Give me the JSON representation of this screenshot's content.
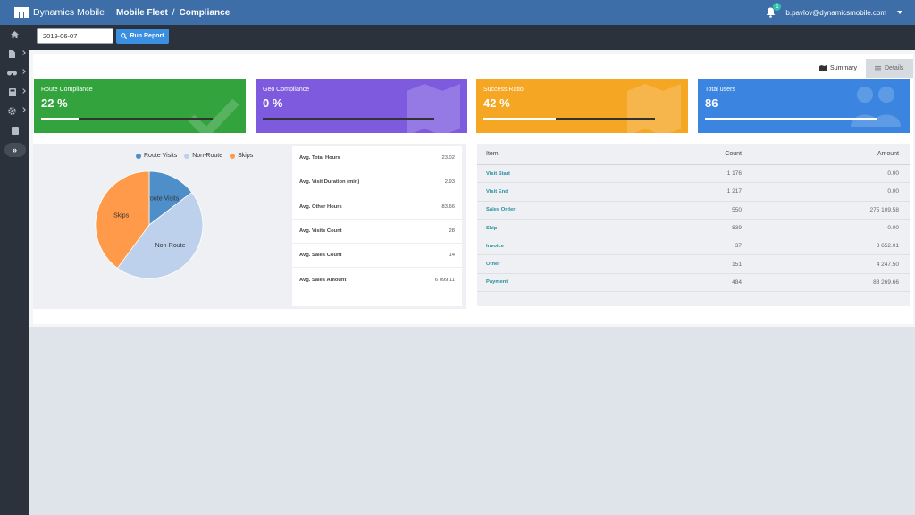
{
  "app": {
    "name": "Dynamics Mobile"
  },
  "breadcrumb": {
    "module": "Mobile Fleet",
    "separator": "/",
    "page": "Compliance"
  },
  "user": {
    "email": "b.pavlov@dynamicsmobile.com",
    "notifications": "1"
  },
  "sidebar": {
    "items": [
      {
        "icon": "home-icon"
      },
      {
        "icon": "document-icon"
      },
      {
        "icon": "binoculars-icon"
      },
      {
        "icon": "calculator-icon"
      },
      {
        "icon": "gear-icon"
      },
      {
        "icon": "book-icon"
      }
    ],
    "toggle_icon": "double-chevron-right-icon"
  },
  "toolbar": {
    "date_value": "2019-06-07",
    "run_label": "Run Report"
  },
  "tabs": [
    {
      "label": "Summary",
      "icon": "map-icon"
    },
    {
      "label": "Details",
      "icon": "list-icon"
    }
  ],
  "cards": [
    {
      "title": "Route Compliance",
      "value": "22 %",
      "progress": 0.22,
      "color": "#33a33d",
      "icon": "check-icon"
    },
    {
      "title": "Geo Compliance",
      "value": "0 %",
      "progress": 0.0,
      "color": "#7e5bde",
      "icon": "map-icon"
    },
    {
      "title": "Success Ratio",
      "value": "42 %",
      "progress": 0.42,
      "color": "#f5a623",
      "icon": "map-icon"
    },
    {
      "title": "Total users",
      "value": "86",
      "progress": 1.0,
      "color": "#3b85e0",
      "icon": "users-icon"
    }
  ],
  "chart_data": {
    "type": "pie",
    "categories": [
      "Route Visits",
      "Non-Route",
      "Skips"
    ],
    "values": [
      14.6,
      45.5,
      39.9
    ],
    "colors": [
      "#4e8fc9",
      "#bdd1ec",
      "#ff9a4a"
    ],
    "legend": "top"
  },
  "stats": [
    {
      "label": "Avg. Total Hours",
      "value": "23.02"
    },
    {
      "label": "Avg. Visit Duration (min)",
      "value": "2.93"
    },
    {
      "label": "Avg. Other Hours",
      "value": "-83.66"
    },
    {
      "label": "Avg. Visits Count",
      "value": "28"
    },
    {
      "label": "Avg. Sales Count",
      "value": "14"
    },
    {
      "label": "Avg. Sales Amount",
      "value": "6 099.11"
    }
  ],
  "table": {
    "headers": {
      "item": "Item",
      "count": "Count",
      "amount": "Amount"
    },
    "rows": [
      {
        "item": "Visit Start",
        "count": "1 176",
        "amount": "0.00"
      },
      {
        "item": "Visit End",
        "count": "1 217",
        "amount": "0.00"
      },
      {
        "item": "Sales Order",
        "count": "550",
        "amount": "275 109.58"
      },
      {
        "item": "Skip",
        "count": "839",
        "amount": "0.00"
      },
      {
        "item": "Invoice",
        "count": "37",
        "amount": "8 652.01"
      },
      {
        "item": "Other",
        "count": "151",
        "amount": "4 247.50"
      },
      {
        "item": "Payment",
        "count": "484",
        "amount": "88 269.66"
      }
    ]
  }
}
